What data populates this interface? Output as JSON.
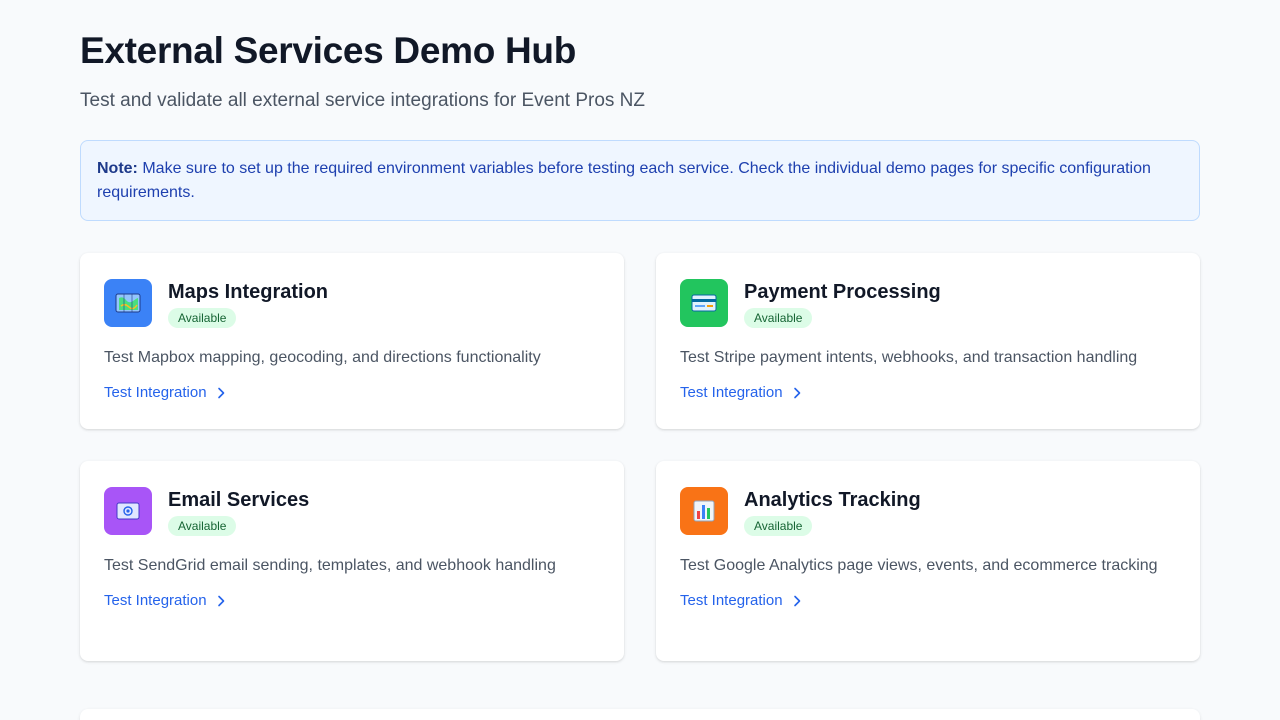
{
  "header": {
    "title": "External Services Demo Hub",
    "subtitle": "Test and validate all external service integrations for Event Pros NZ"
  },
  "note": {
    "label": "Note:",
    "text": " Make sure to set up the required environment variables before testing each service. Check the individual demo pages for specific configuration requirements."
  },
  "cards": [
    {
      "title": "Maps Integration",
      "badge": "Available",
      "description": "Test Mapbox mapping, geocoding, and directions functionality",
      "link": "Test Integration",
      "icon": "map-icon",
      "color": "#3b82f6"
    },
    {
      "title": "Payment Processing",
      "badge": "Available",
      "description": "Test Stripe payment intents, webhooks, and transaction handling",
      "link": "Test Integration",
      "icon": "credit-card-icon",
      "color": "#22c55e"
    },
    {
      "title": "Email Services",
      "badge": "Available",
      "description": "Test SendGrid email sending, templates, and webhook handling",
      "link": "Test Integration",
      "icon": "email-icon",
      "color": "#a855f7"
    },
    {
      "title": "Analytics Tracking",
      "badge": "Available",
      "description": "Test Google Analytics page views, events, and ecommerce tracking",
      "link": "Test Integration",
      "icon": "bar-chart-icon",
      "color": "#f97316"
    }
  ],
  "colors": {
    "accent": "#2563eb",
    "badge_bg": "#dcfce7",
    "badge_text": "#166534",
    "note_bg": "#eff6ff"
  }
}
